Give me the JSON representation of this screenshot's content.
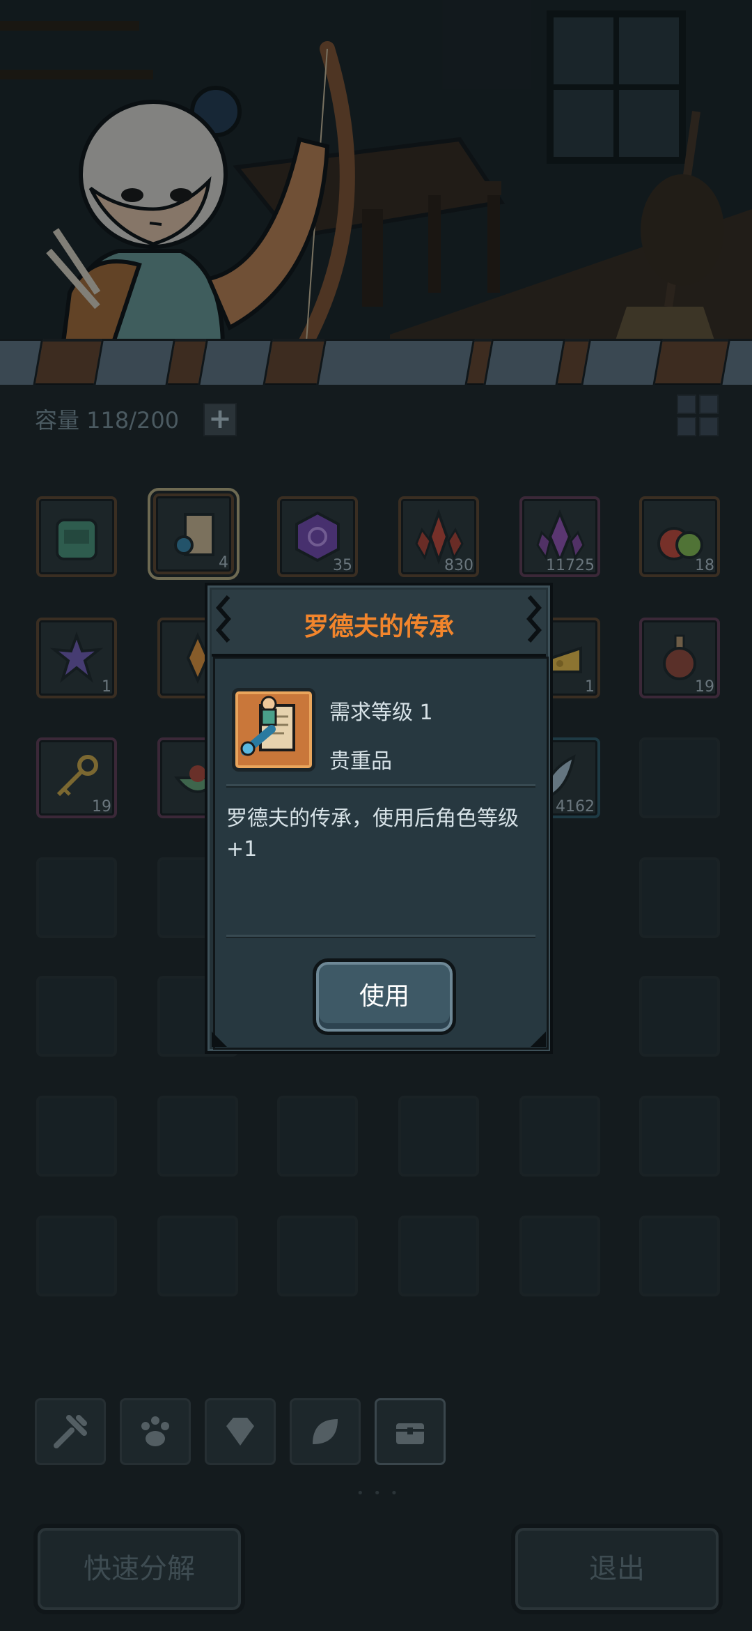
{
  "inventory": {
    "capacity_text": "容量 118/200",
    "plus_label": "+",
    "slots": [
      {
        "count": ""
      },
      {
        "count": "4"
      },
      {
        "count": "35"
      },
      {
        "count": "830"
      },
      {
        "count": "11725"
      },
      {
        "count": "18"
      },
      {
        "count": "1"
      },
      {
        "count": "19"
      },
      {
        "count": "1"
      },
      {
        "count": "19"
      },
      {
        "count": "19"
      },
      {
        "count": "4162"
      }
    ]
  },
  "tabs": [
    "tools-icon",
    "paw-icon",
    "gem-icon",
    "leaf-icon",
    "chest-icon"
  ],
  "buttons": {
    "quick_decompose": "快速分解",
    "exit": "退出"
  },
  "modal": {
    "title": "罗德夫的传承",
    "required_level": "需求等级 1",
    "rarity": "贵重品",
    "description": "罗德夫的传承，使用后角色等级+1",
    "use_button": "使用"
  },
  "colors": {
    "title_orange": "#f2852c",
    "modal_bg": "#273840",
    "button_bg": "#3e5966"
  }
}
